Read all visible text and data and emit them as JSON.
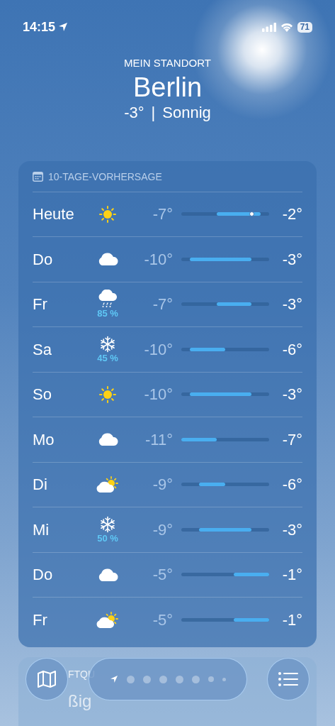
{
  "status_bar": {
    "time": "14:15",
    "battery": "71"
  },
  "header": {
    "caption": "MEIN STANDORT",
    "city": "Berlin",
    "temperature": "-3°",
    "separator": "|",
    "condition": "Sonnig"
  },
  "forecast": {
    "title": "10-TAGE-VORHERSAGE",
    "days": [
      {
        "day": "Heute",
        "kind": "sun",
        "low": "-7°",
        "high": "-2°",
        "current_marker": true
      },
      {
        "day": "Do",
        "kind": "cloud",
        "low": "-10°",
        "high": "-3°",
        "current_marker": false
      },
      {
        "day": "Fr",
        "kind": "sleet",
        "precipitation": "85 %",
        "low": "-7°",
        "high": "-3°",
        "current_marker": false
      },
      {
        "day": "Sa",
        "kind": "snow",
        "precipitation": "45 %",
        "low": "-10°",
        "high": "-6°",
        "current_marker": false
      },
      {
        "day": "So",
        "kind": "sun",
        "low": "-10°",
        "high": "-3°",
        "current_marker": false
      },
      {
        "day": "Mo",
        "kind": "cloud",
        "low": "-11°",
        "high": "-7°",
        "current_marker": false
      },
      {
        "day": "Di",
        "kind": "partly_sunny",
        "low": "-9°",
        "high": "-6°",
        "current_marker": false
      },
      {
        "day": "Mi",
        "kind": "snow",
        "precipitation": "50 %",
        "low": "-9°",
        "high": "-3°",
        "current_marker": false
      },
      {
        "day": "Do",
        "kind": "cloud",
        "low": "-5°",
        "high": "-1°",
        "current_marker": false
      },
      {
        "day": "Fr",
        "kind": "partly_sunny",
        "low": "-5°",
        "high": "-1°",
        "current_marker": false
      }
    ]
  },
  "next_card": {
    "title": "FTQU",
    "value": "ßig"
  },
  "pages": [
    {
      "kind": "location",
      "selected": true
    },
    {
      "kind": "dot",
      "selected": false
    },
    {
      "kind": "dot",
      "selected": false
    },
    {
      "kind": "dot",
      "selected": false
    },
    {
      "kind": "dot",
      "selected": false
    },
    {
      "kind": "dot",
      "selected": false
    },
    {
      "kind": "dot",
      "selected": false
    },
    {
      "kind": "dot",
      "selected": false
    }
  ]
}
